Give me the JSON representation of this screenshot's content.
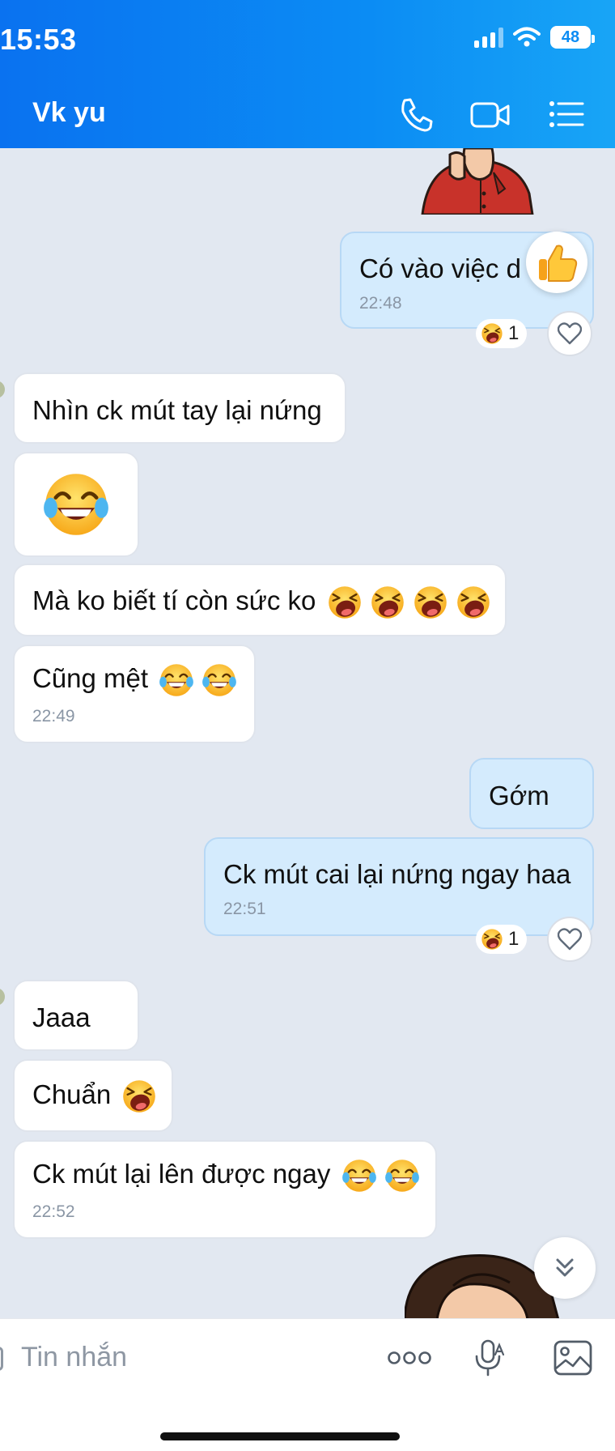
{
  "status_bar": {
    "time": "15:53",
    "battery": "48"
  },
  "header": {
    "title": "Vk yu",
    "icons": [
      "phone-icon",
      "video-call-icon",
      "menu-list-icon"
    ]
  },
  "messages": [
    {
      "id": "m1",
      "direction": "out",
      "text": "Có vào việc d",
      "time": "22:48",
      "reaction_count": "1",
      "overlay_icon": "thumbs-up-icon"
    },
    {
      "id": "m2",
      "direction": "in",
      "text": "Nhìn ck mút tay lại nứng"
    },
    {
      "id": "m3",
      "direction": "in",
      "text": "",
      "emoji_only": "tears-of-joy"
    },
    {
      "id": "m4",
      "direction": "in",
      "text": "Mà ko biết tí còn sức ko",
      "emojis": [
        "laughing-face",
        "laughing-face",
        "laughing-face",
        "laughing-face"
      ]
    },
    {
      "id": "m5",
      "direction": "in",
      "text": "Cũng mệt",
      "emojis": [
        "tears-of-joy",
        "tears-of-joy"
      ],
      "time": "22:49"
    },
    {
      "id": "m6",
      "direction": "out",
      "text": "Gớm"
    },
    {
      "id": "m7",
      "direction": "out",
      "text": "Ck mút cai lại nứng ngay haa",
      "time": "22:51",
      "reaction_count": "1"
    },
    {
      "id": "m8",
      "direction": "in",
      "text": "Jaaa"
    },
    {
      "id": "m9",
      "direction": "in",
      "text": "Chuẩn",
      "emojis": [
        "laughing-face"
      ]
    },
    {
      "id": "m10",
      "direction": "in",
      "text": "Ck mút lại lên được ngay",
      "emojis": [
        "tears-of-joy",
        "tears-of-joy"
      ],
      "time": "22:52"
    }
  ],
  "input_bar": {
    "placeholder": "Tin nhắn"
  },
  "colors": {
    "header_start": "#0a72f0",
    "header_end": "#18a5f6",
    "bubble_out": "#d4ebfd",
    "bubble_in": "#ffffff",
    "chat_bg": "#e2e8f1"
  }
}
